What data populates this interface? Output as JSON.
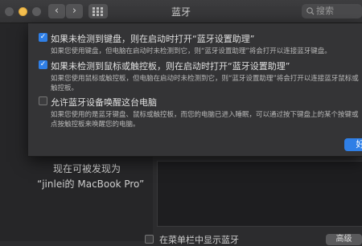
{
  "window": {
    "title": "蓝牙",
    "search_placeholder": "搜索",
    "back_glyph": "‹",
    "forward_glyph": "›"
  },
  "sheet": {
    "options": [
      {
        "checked": true,
        "label": "如果未检测到键盘，则在启动时打开“蓝牙设置助理”",
        "description": "如果您使用键盘，但电脑在启动时未检测到它，则“蓝牙设置助理”将会打开以连接蓝牙键盘。"
      },
      {
        "checked": true,
        "label": "如果未检测到鼠标或触控板，则在启动时打开“蓝牙设置助理”",
        "description": "如果您使用鼠标或触控板，但电脑在启动时未检测到它，则“蓝牙设置助理”将会打开以连接蓝牙鼠标或触控板。"
      },
      {
        "checked": false,
        "label": "允许蓝牙设备唤醒这台电脑",
        "description": "如果您使用的是蓝牙键盘、鼠标或触控板，而您的电脑已进入睡眠，可以通过按下键盘上的某个按键或点按触控板来唤醒您的电脑。"
      }
    ],
    "ok_label": "好"
  },
  "background": {
    "discover_text": "现在可被发现为",
    "device_name": "“jinlei的 MacBook Pro”",
    "menubar_label": "在菜单栏中显示蓝牙",
    "advanced_label": "高级"
  },
  "colors": {
    "accent": "#2f7fe6",
    "window_bg": "#2c2c2e",
    "sheet_bg": "#343436"
  }
}
